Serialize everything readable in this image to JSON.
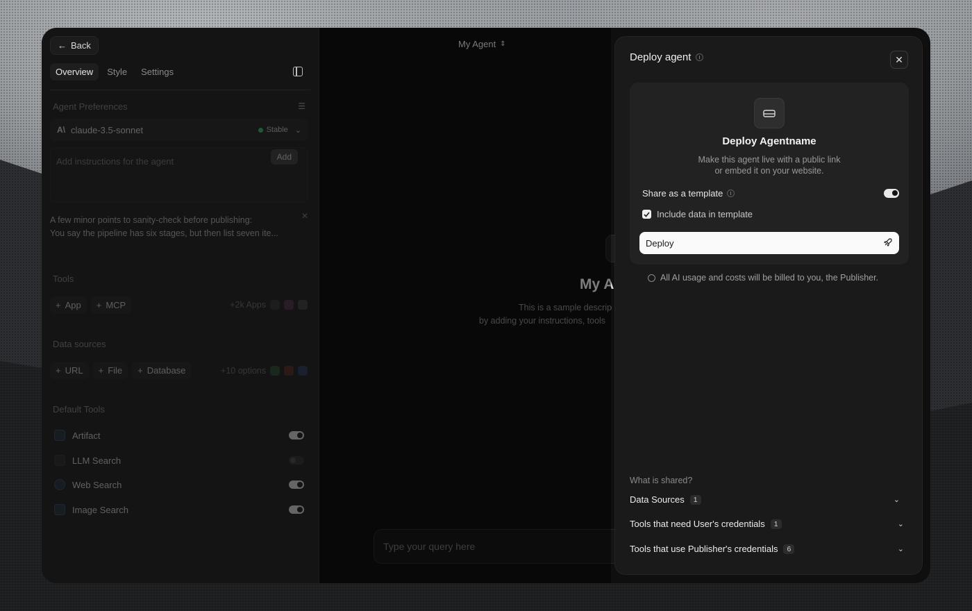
{
  "window": {
    "back_label": "Back",
    "agent_title": "My Agent"
  },
  "sidebar": {
    "tabs": [
      "Overview",
      "Style",
      "Settings"
    ],
    "preferences_title": "Agent Preferences",
    "model_name": "claude-3.5-sonnet",
    "model_status": "Stable",
    "instructions_placeholder": "Add instructions for the agent",
    "add_label": "Add",
    "note_line1": "A few minor points to sanity-check before publishing:",
    "note_line2": "You say the pipeline has six stages, but then list seven ite...",
    "tools_title": "Tools",
    "tool_chips": [
      "App",
      "MCP"
    ],
    "tools_more": "+2k Apps",
    "data_sources_title": "Data sources",
    "data_chips": [
      "URL",
      "File",
      "Database"
    ],
    "data_more": "+10 options",
    "default_tools_title": "Default Tools",
    "default_tools": [
      {
        "label": "Artifact",
        "on": true
      },
      {
        "label": "LLM Search",
        "on": false
      },
      {
        "label": "Web Search",
        "on": true
      },
      {
        "label": "Image Search",
        "on": true
      }
    ]
  },
  "center": {
    "title": "My A",
    "desc_line1": "This is a sample descrip",
    "desc_line2": "by adding your instructions, tools",
    "query_placeholder": "Type your query here"
  },
  "deploy": {
    "title": "Deploy agent",
    "card_title": "Deploy Agentname",
    "card_desc_line1": "Make this agent live with a public link",
    "card_desc_line2": "or embed it on your website.",
    "share_label": "Share as a template",
    "share_on": true,
    "include_label": "Include data in template",
    "include_checked": true,
    "deploy_button": "Deploy",
    "billing_note": "All AI usage and costs will be billed to you, the Publisher.",
    "shared_title": "What is shared?",
    "shared_items": [
      {
        "label": "Data Sources",
        "count": "1"
      },
      {
        "label": "Tools that need User's credentials",
        "count": "1"
      },
      {
        "label": "Tools that use Publisher's credentials",
        "count": "6"
      }
    ]
  }
}
